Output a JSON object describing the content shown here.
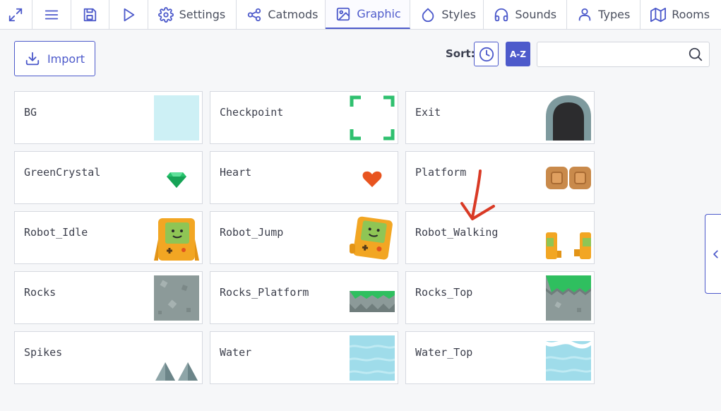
{
  "toolbar": {
    "icons": [
      "fullscreen-icon",
      "menu-icon",
      "save-icon",
      "play-icon"
    ],
    "tabs": [
      {
        "label": "Settings",
        "icon": "gear-icon",
        "active": false
      },
      {
        "label": "Catmods",
        "icon": "nodes-icon",
        "active": false
      },
      {
        "label": "Graphic",
        "icon": "image-icon",
        "active": true
      },
      {
        "label": "Styles",
        "icon": "droplet-icon",
        "active": false
      },
      {
        "label": "Sounds",
        "icon": "headphones-icon",
        "active": false
      },
      {
        "label": "Types",
        "icon": "user-icon",
        "active": false
      },
      {
        "label": "Rooms",
        "icon": "map-icon",
        "active": false
      }
    ]
  },
  "controls": {
    "import_label": "Import",
    "sort_label": "Sort:",
    "sort_az_label": "A-Z",
    "search_value": "",
    "search_placeholder": ""
  },
  "textures": [
    {
      "name": "BG"
    },
    {
      "name": "Checkpoint"
    },
    {
      "name": "Exit"
    },
    {
      "name": "GreenCrystal"
    },
    {
      "name": "Heart"
    },
    {
      "name": "Platform"
    },
    {
      "name": "Robot_Idle"
    },
    {
      "name": "Robot_Jump"
    },
    {
      "name": "Robot_Walking"
    },
    {
      "name": "Rocks"
    },
    {
      "name": "Rocks_Platform"
    },
    {
      "name": "Rocks_Top"
    },
    {
      "name": "Spikes"
    },
    {
      "name": "Water"
    },
    {
      "name": "Water_Top"
    }
  ],
  "colors": {
    "accent": "#4d5acb",
    "annotation": "#d93a25"
  }
}
